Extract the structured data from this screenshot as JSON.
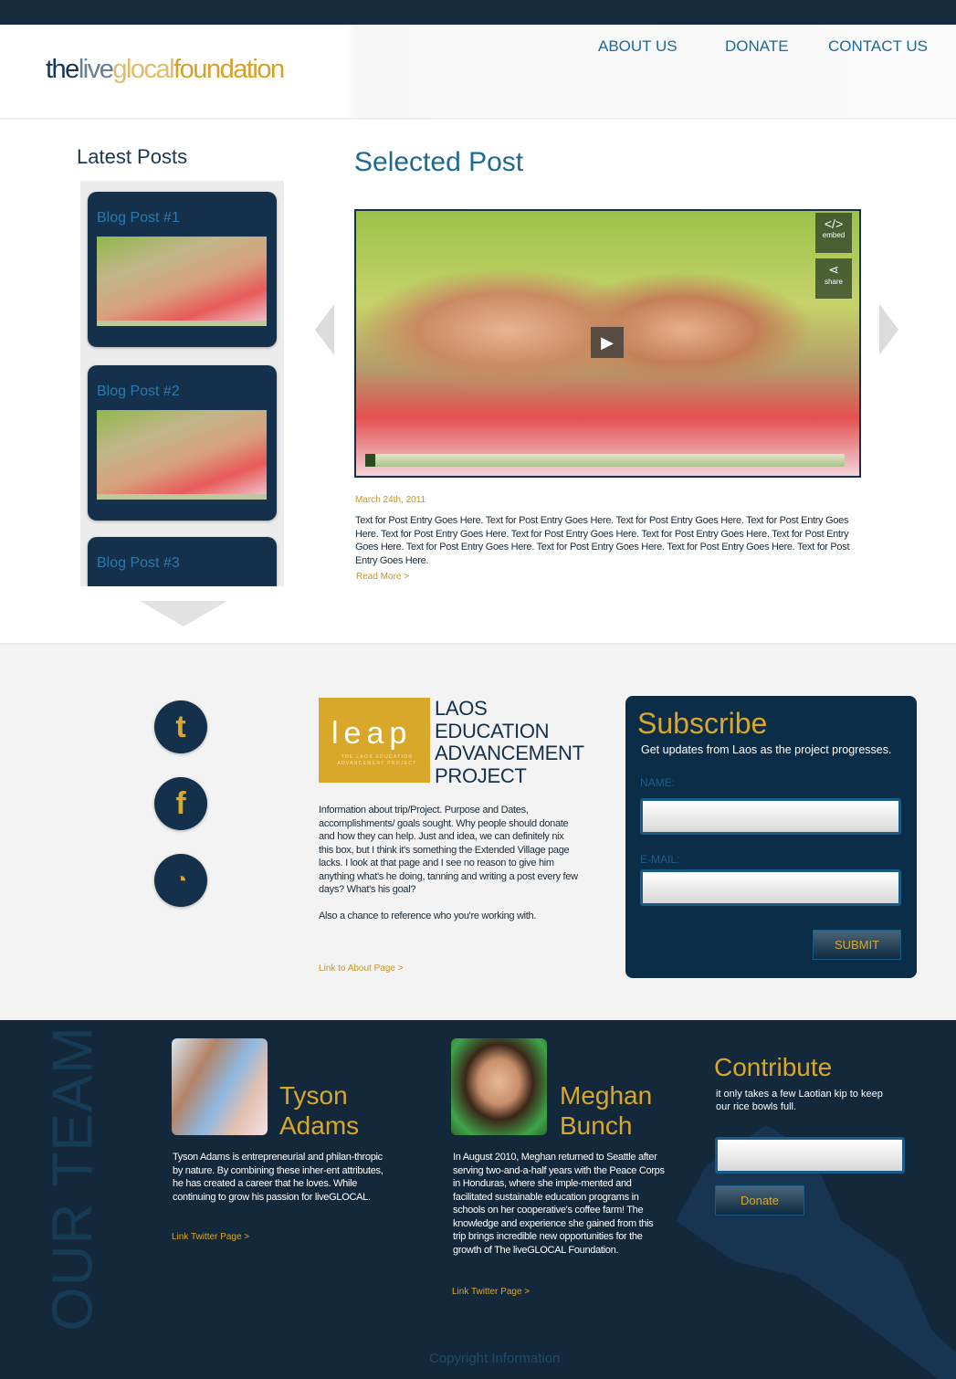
{
  "header": {
    "logo": {
      "part1": "the",
      "part2": "live",
      "part3": "glocal",
      "part4": "foundation"
    },
    "nav": [
      {
        "label": "ABOUT US"
      },
      {
        "label": "DONATE"
      },
      {
        "label": "CONTACT US"
      }
    ]
  },
  "latest": {
    "title": "Latest Posts",
    "posts": [
      {
        "title": "Blog Post #1"
      },
      {
        "title": "Blog Post #2"
      },
      {
        "title": "Blog Post #3"
      }
    ]
  },
  "selected": {
    "title": "Selected Post",
    "video": {
      "embed_label": "embed",
      "share_label": "share",
      "embed_icon": "</>",
      "progress": 0.02
    },
    "date": "March 24th, 2011",
    "text": "Text for Post Entry Goes Here. Text for Post Entry Goes Here. Text for Post Entry Goes Here. Text for Post Entry Goes Here. Text for Post Entry Goes Here. Text for Post Entry Goes Here. Text for Post Entry Goes Here. Text for Post Entry Goes Here. Text for Post Entry Goes Here. Text for Post Entry Goes Here. Text for Post Entry Goes Here. Text for Post Entry Goes Here.",
    "read_more": "Read More >"
  },
  "social": [
    {
      "icon": "twitter-icon",
      "glyph": "t"
    },
    {
      "icon": "facebook-icon",
      "glyph": "f"
    },
    {
      "icon": "rss-icon",
      "glyph": "))"
    }
  ],
  "project": {
    "logo_mark": "leap",
    "logo_sub": "THE LAOS EDUCATION ADVANCEMENT PROJECT",
    "heading": [
      "LAOS",
      "EDUCATION",
      "ADVANCEMENT",
      "PROJECT"
    ],
    "p1": "Information about trip/Project. Purpose and Dates, accomplishments/ goals sought.",
    "p1b": "Why people should donate and how they can help. Just and idea, we can definitely nix this box, but I think it's something the Extended Village page lacks. I look at that page and I see no reason to give him anything what's he doing, tanning and writing a post every few days? What's his goal?",
    "p2": "Also a chance to reference who you're working with.",
    "link": "Link to About Page >"
  },
  "subscribe": {
    "title": "Subscribe",
    "text": "Get updates from Laos as the project progresses.",
    "name_label": "NAME:",
    "email_label": "E-MAIL:",
    "name_value": "",
    "email_value": "",
    "submit": "SUBMIT"
  },
  "team": {
    "title": "OUR TEAM",
    "members": [
      {
        "first": "Tyson",
        "last": "Adams",
        "bio": "Tyson Adams is entrepreneurial and philan-thropic by nature. By combining these inher-ent attributes, he has created a career that he loves. While continuing to grow his passion for liveGLOCAL.",
        "link": "Link Twitter Page >"
      },
      {
        "first": "Meghan",
        "last": "Bunch",
        "bio": "In August 2010, Meghan returned to Seattle after serving two-and-a-half years with the Peace Corps in Honduras, where she imple-mented and facilitated sustainable education programs in schools on her cooperative's coffee farm! The knowledge and experience she gained from this trip brings incredible new opportunities for the growth of The liveGLOCAL Foundation.",
        "link": "Link Twitter Page >"
      }
    ]
  },
  "contribute": {
    "title": "Contribute",
    "text": "it only takes a few Laotian kip to keep our rice bowls full.",
    "amount_value": "",
    "donate": "Donate"
  },
  "footer": {
    "copyright": "Copyright Information"
  },
  "colors": {
    "navy": "#14304a",
    "gold": "#d9a82a",
    "blue": "#1e6a94",
    "footer_bg": "#13283b"
  }
}
